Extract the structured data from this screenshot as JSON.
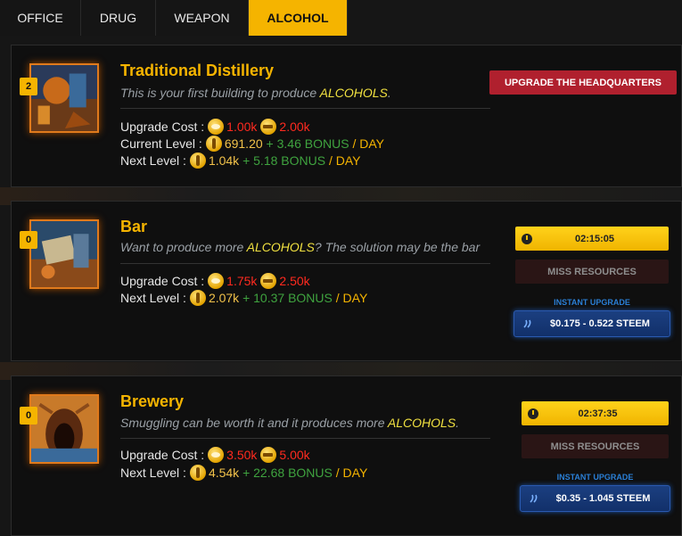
{
  "tabs": [
    {
      "label": "OFFICE",
      "active": false
    },
    {
      "label": "DRUG",
      "active": false
    },
    {
      "label": "WEAPON",
      "active": false
    },
    {
      "label": "ALCOHOL",
      "active": true
    }
  ],
  "buildings": [
    {
      "level": "2",
      "title": "Traditional Distillery",
      "desc_pre": "This is your first building to produce ",
      "desc_hl": "ALCOHOLS",
      "desc_post": ".",
      "upgrade_cost_label": "Upgrade Cost :",
      "cost_coin": "1.00k",
      "cost_gun": "2.00k",
      "current_label": "Current Level :",
      "current_value": "691.20",
      "current_bonus": "+ 3.46 BONUS",
      "current_unit": "/ DAY",
      "next_label": "Next Level :",
      "next_value": "1.04k",
      "next_bonus": "+ 5.18 BONUS",
      "next_unit": "/ DAY",
      "action_label": "UPGRADE THE HEADQUARTERS"
    },
    {
      "level": "0",
      "title": "Bar",
      "desc_pre": "Want to produce more ",
      "desc_hl": "ALCOHOLS",
      "desc_post": "? The solution may be the bar",
      "upgrade_cost_label": "Upgrade Cost :",
      "cost_coin": "1.75k",
      "cost_gun": "2.50k",
      "next_label": "Next Level :",
      "next_value": "2.07k",
      "next_bonus": "+ 10.37 BONUS",
      "next_unit": "/ DAY",
      "timer": "02:15:05",
      "miss_label": "MISS RESOURCES",
      "instant_label": "INSTANT UPGRADE",
      "steem_price": "$0.175 - 0.522 STEEM"
    },
    {
      "level": "0",
      "title": "Brewery",
      "desc_pre": "Smuggling can be worth it and it produces more ",
      "desc_hl": "ALCOHOLS",
      "desc_post": ".",
      "upgrade_cost_label": "Upgrade Cost :",
      "cost_coin": "3.50k",
      "cost_gun": "5.00k",
      "next_label": "Next Level :",
      "next_value": "4.54k",
      "next_bonus": "+ 22.68 BONUS",
      "next_unit": "/ DAY",
      "timer": "02:37:35",
      "miss_label": "MISS RESOURCES",
      "instant_label": "INSTANT UPGRADE",
      "steem_price": "$0.35 - 1.045 STEEM"
    }
  ],
  "colors": {
    "accent": "#f5b400",
    "cost": "#ff2a1f",
    "bonus": "#3fa33f",
    "upgrade_hq": "#b0202e",
    "steem": "#1b3f80"
  },
  "icons": [
    "coin-icon",
    "gun-icon",
    "bottle-icon",
    "clock-icon",
    "steem-icon"
  ]
}
